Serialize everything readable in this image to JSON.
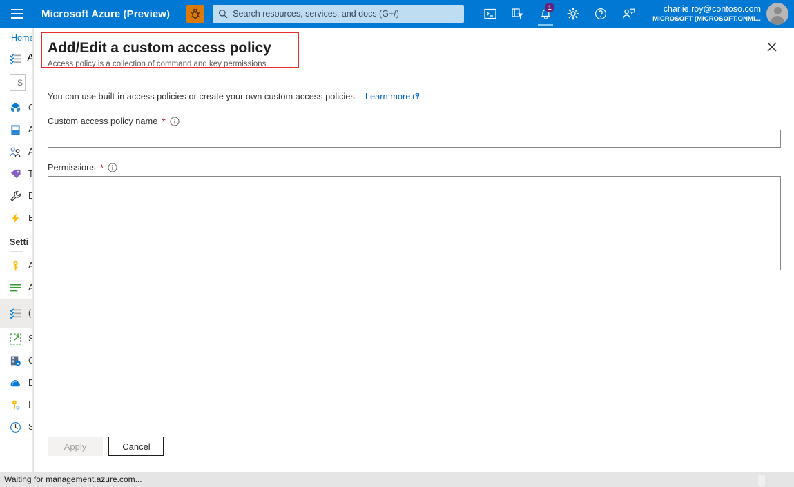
{
  "topbar": {
    "menu_icon": "hamburger-icon",
    "brand": "Microsoft Azure (Preview)",
    "dev_icon": "bug-icon",
    "search": {
      "icon": "search-icon",
      "placeholder": "Search resources, services, and docs (G+/)",
      "value": ""
    },
    "icons": [
      {
        "name": "cloud-shell-icon",
        "title": "Cloud Shell"
      },
      {
        "name": "directories-filter-icon",
        "title": "Directories + subscriptions"
      },
      {
        "name": "notifications-bell-icon",
        "title": "Notifications",
        "badge": "1"
      },
      {
        "name": "gear-icon",
        "title": "Settings"
      },
      {
        "name": "help-question-icon",
        "title": "Help"
      },
      {
        "name": "feedback-icon",
        "title": "Feedback"
      }
    ],
    "account": {
      "email": "charlie.roy@contoso.com",
      "tenant": "MICROSOFT (MICROSOFT.ONMI...",
      "avatar": "user-avatar-icon"
    }
  },
  "sidebar": {
    "breadcrumb": "Home",
    "title": "A",
    "title_icon": "checklist-icon",
    "search_placeholder": "S",
    "search_icon": "search-icon",
    "items": [
      {
        "label": "O",
        "icon": "overview-cube-icon",
        "selected": false
      },
      {
        "label": "A",
        "icon": "activity-log-icon",
        "selected": false
      },
      {
        "label": "A",
        "icon": "access-control-users-icon",
        "selected": false
      },
      {
        "label": "T",
        "icon": "tags-icon",
        "selected": false
      },
      {
        "label": "D",
        "icon": "diagnose-wrench-icon",
        "selected": false
      },
      {
        "label": "E",
        "icon": "events-bolt-icon",
        "selected": false
      }
    ],
    "settings_group": "Setti",
    "settings_items": [
      {
        "label": "A",
        "icon": "key-icon",
        "selected": false
      },
      {
        "label": "A",
        "icon": "advanced-settings-icon",
        "selected": false
      },
      {
        "label": "( C",
        "icon": "access-policies-checklist-icon",
        "selected": true
      },
      {
        "label": "S",
        "icon": "export-template-icon",
        "selected": false
      },
      {
        "label": "C",
        "icon": "connection-server-icon",
        "selected": false
      },
      {
        "label": "D",
        "icon": "data-cloud-icon",
        "selected": false
      },
      {
        "label": "I",
        "icon": "identity-key-icon",
        "selected": false
      },
      {
        "label": "S",
        "icon": "schedule-clock-icon",
        "selected": false
      }
    ]
  },
  "dialog": {
    "title": "Add/Edit a custom access policy",
    "subtitle": "Access policy is a collection of command and key permissions.",
    "close_icon": "close-icon",
    "highlight_color": "#ec2d2d",
    "intro_text": "You can use built-in access policies or create your own custom access policies.",
    "learn_more": "Learn more",
    "learn_more_icon": "external-link-icon",
    "fields": [
      {
        "label": "Custom access policy name",
        "required_marker": "*",
        "info_icon": "info-circle-icon",
        "value": "",
        "placeholder": ""
      },
      {
        "label": "Permissions",
        "required_marker": "*",
        "info_icon": "info-circle-icon",
        "value": "",
        "placeholder": ""
      }
    ],
    "apply_label": "Apply",
    "cancel_label": "Cancel"
  },
  "statusbar": {
    "text": "Waiting for management.azure.com..."
  },
  "colors": {
    "azure_blue": "#0078d4",
    "accent_link": "#0066cc",
    "required_red": "#a4262c",
    "highlight_red": "#ec2d2d",
    "badge_purple": "#68217a",
    "dev_orange": "#d97b06"
  }
}
